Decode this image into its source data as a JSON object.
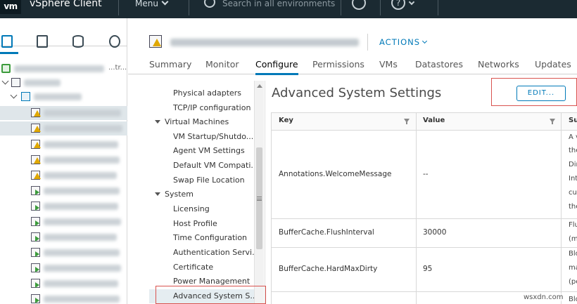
{
  "topbar": {
    "logo": "vm",
    "app_title": "vSphere Client",
    "menu_label": "Menu",
    "search_placeholder": "Search in all environments"
  },
  "tree": {
    "root_suffix": "...tr..."
  },
  "object": {
    "actions_label": "ACTIONS"
  },
  "tabs": [
    {
      "label": "Summary"
    },
    {
      "label": "Monitor"
    },
    {
      "label": "Configure"
    },
    {
      "label": "Permissions"
    },
    {
      "label": "VMs"
    },
    {
      "label": "Datastores"
    },
    {
      "label": "Networks"
    },
    {
      "label": "Updates"
    }
  ],
  "active_tab": "Configure",
  "subnav": {
    "items": [
      {
        "label": "Physical adapters",
        "type": "item"
      },
      {
        "label": "TCP/IP configuration",
        "type": "item"
      },
      {
        "label": "Virtual Machines",
        "type": "group"
      },
      {
        "label": "VM Startup/Shutdo...",
        "type": "item"
      },
      {
        "label": "Agent VM Settings",
        "type": "item"
      },
      {
        "label": "Default VM Compati...",
        "type": "item"
      },
      {
        "label": "Swap File Location",
        "type": "item"
      },
      {
        "label": "System",
        "type": "group"
      },
      {
        "label": "Licensing",
        "type": "item"
      },
      {
        "label": "Host Profile",
        "type": "item"
      },
      {
        "label": "Time Configuration",
        "type": "item"
      },
      {
        "label": "Authentication Servi...",
        "type": "item"
      },
      {
        "label": "Certificate",
        "type": "item"
      },
      {
        "label": "Power Management",
        "type": "item"
      },
      {
        "label": "Advanced System S...",
        "type": "item",
        "selected": true
      }
    ]
  },
  "content": {
    "title": "Advanced System Settings",
    "edit_label": "EDIT...",
    "columns": [
      "Key",
      "Value",
      "Su"
    ],
    "rows": [
      {
        "key": "Annotations.WelcomeMessage",
        "value": "--",
        "summary": [
          "A v",
          "the",
          "Dir",
          "Int",
          "cur",
          "the"
        ]
      },
      {
        "key": "BufferCache.FlushInterval",
        "value": "30000",
        "summary": [
          "Flu",
          "(ml"
        ]
      },
      {
        "key": "BufferCache.HardMaxDirty",
        "value": "95",
        "summary": [
          "Blo",
          "ma",
          "(pe"
        ]
      },
      {
        "key": "",
        "value": "",
        "summary": [
          "Blo"
        ]
      }
    ]
  },
  "watermark": "wsxdn.com",
  "colors": {
    "topbar_bg": "#1b2a32",
    "accent": "#0079b8",
    "highlight_red": "#d9534f",
    "warning": "#e0a800",
    "powered_on": "#3c9b3c"
  }
}
